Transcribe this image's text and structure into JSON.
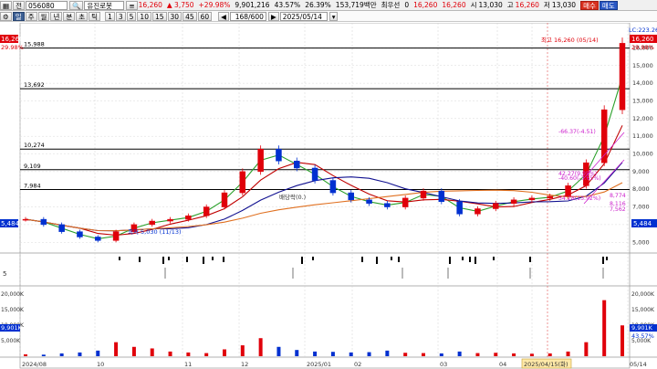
{
  "toolbar": {
    "menu_icon": "grid-menu-icon",
    "market": "전",
    "stock_code": "056080",
    "stock_name": "유진로봇",
    "price": "16,260",
    "change": "▲ 3,750",
    "change_rate": "+29.98%",
    "volume": "9,901,216",
    "volume_ratio": "43.57%",
    "turnover": "26.39%",
    "amount": "153,719백만",
    "priority_label": "최우선",
    "zero_label": "0",
    "ask_price": "16,260",
    "bid_price": "16,260",
    "open_label": "시",
    "open": "13,030",
    "high_label": "고",
    "high": "16,260",
    "low_label": "저",
    "low": "13,030",
    "buy_label": "매수",
    "sell_label": "매도"
  },
  "period_bar": {
    "periods": [
      "일",
      "주",
      "월",
      "년",
      "분",
      "초",
      "틱"
    ],
    "selected": "일",
    "intervals": [
      "1",
      "3",
      "5",
      "10",
      "15",
      "30",
      "45",
      "60"
    ],
    "count": "168/600",
    "date": "2025/05/14"
  },
  "price_chart": {
    "left_tag_price": "16,260",
    "left_tag_rate": "29.98%",
    "right_tag_price": "16,260",
    "right_tag_rate": "29.98%",
    "lc_label": "LC:223.26",
    "hlines": [
      {
        "value": 15988,
        "label": "15,988"
      },
      {
        "value": 13692,
        "label": "13,692"
      },
      {
        "value": 10274,
        "label": "10,274"
      },
      {
        "value": 9109,
        "label": "9,109"
      },
      {
        "value": 7984,
        "label": "7,984"
      }
    ],
    "last_close_label": "5,484",
    "high_annotation": "최고 16,260 (05/14)",
    "low_annotation": "최저 5,030 (11/13)",
    "dividend_annotation": "배당락(0.)",
    "fib_labels": [
      "-66.37(-4.51)",
      "42.27(9.95%)",
      "-40.60(-3.65%)",
      "34.28(13.92%)",
      "8,116",
      "8,774",
      "7,562"
    ],
    "y_ticks": [
      "16,000",
      "15,000",
      "14,000",
      "13,000",
      "12,000",
      "11,000",
      "10,000",
      "9,000",
      "8,000",
      "7,000",
      "6,000",
      "5,000"
    ]
  },
  "signal_panel": {
    "label": "5"
  },
  "volume_chart": {
    "left_ticks": [
      "20,000K",
      "15,000K",
      "10,000K",
      "5,000K"
    ],
    "right_ticks": [
      "20,000K",
      "15,000K",
      "10,000K",
      "5,000K"
    ],
    "left_tag": "9,901K",
    "right_tag": "9,901K",
    "right_tag_rate": "43.57%"
  },
  "x_axis": {
    "labels": [
      "2024/08",
      "10",
      "11",
      "12",
      "2025/01",
      "02",
      "03",
      "04",
      "05",
      "05/14"
    ],
    "crosshair_label": "2025/04/15(화)"
  },
  "colors": {
    "up": "#e0000a",
    "down": "#0030d0",
    "ma5": "#2aa02a",
    "ma20": "#c00000",
    "ma60": "#101090",
    "ma120": "#e07020",
    "fib": "#cc22cc"
  },
  "chart_data": {
    "type": "candlestick",
    "x": [
      "2024/08",
      "10",
      "11",
      "12",
      "2025/01",
      "02",
      "03",
      "04",
      "05",
      "05/14"
    ],
    "series": [
      {
        "name": "price",
        "values": [
          6300,
          6000,
          5600,
          5300,
          5100,
          5600,
          6000,
          6200,
          6300,
          6500,
          7000,
          7800,
          9000,
          10274,
          9600,
          9200,
          8500,
          7800,
          7400,
          7200,
          7000,
          7500,
          7900,
          7300,
          6600,
          6900,
          7200,
          7400,
          7500,
          7600,
          8200,
          9500,
          12500,
          16260
        ]
      },
      {
        "name": "volume",
        "values": [
          600,
          500,
          900,
          1200,
          1800,
          4500,
          3000,
          2500,
          1500,
          1200,
          1000,
          2200,
          3500,
          5800,
          3000,
          2000,
          1500,
          1400,
          1200,
          1300,
          1800,
          1100,
          1000,
          900,
          1500,
          1000,
          1100,
          900,
          800,
          900,
          1500,
          4500,
          18000,
          9901
        ]
      }
    ],
    "ylim": [
      4600,
      16900
    ],
    "volume_ylim": [
      0,
      22000
    ]
  }
}
